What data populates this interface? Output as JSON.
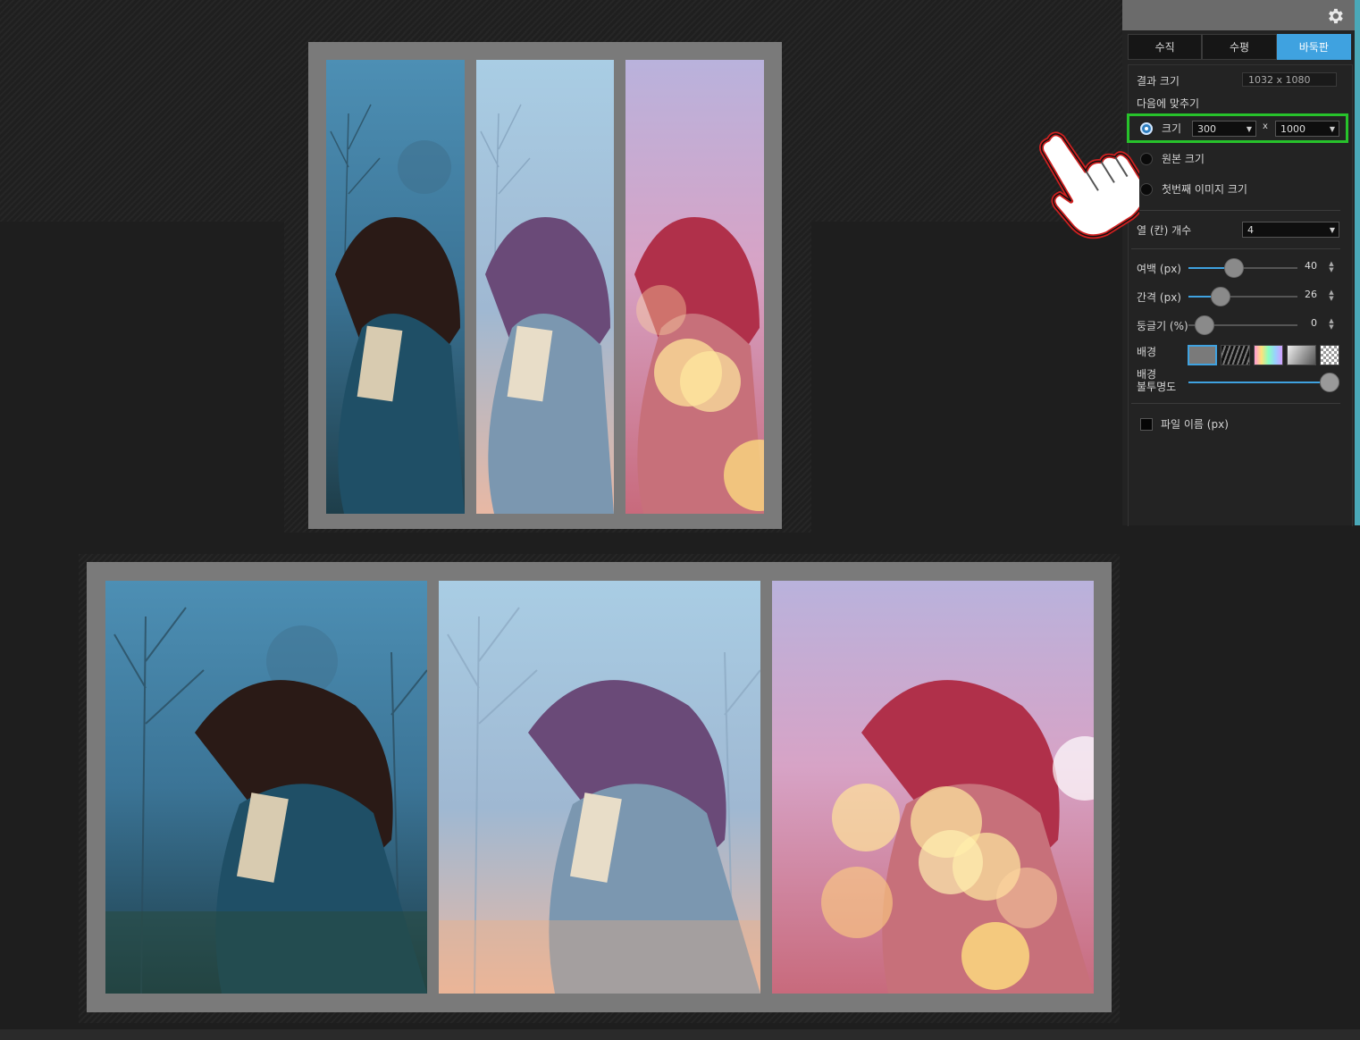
{
  "panel": {
    "tabs": [
      {
        "label": "수직",
        "active": false
      },
      {
        "label": "수평",
        "active": false
      },
      {
        "label": "바둑판",
        "active": true
      }
    ],
    "result_size_label": "결과 크기",
    "result_size_value": "1032 x 1080",
    "fit_to_label": "다음에 맞추기",
    "size_option_label": "크기",
    "size_width": "300",
    "size_x": "x",
    "size_height": "1000",
    "original_size_label": "원본 크기",
    "first_image_size_label": "첫번째 이미지 크기",
    "columns_label": "열 (칸) 개수",
    "columns_value": "4",
    "margin_label": "여백 (px)",
    "margin_value": "40",
    "spacing_label": "간격 (px)",
    "spacing_value": "26",
    "roundness_label": "둥글기 (%)",
    "roundness_value": "0",
    "background_label": "배경",
    "background_opacity_label_1": "배경",
    "background_opacity_label_2": "불투명도",
    "filename_label": "파일 이름 (px)",
    "accent_color": "#3fa2e0",
    "highlight_color": "#27c22b"
  },
  "icons": {
    "settings": "gear-icon",
    "pointer": "pointing-hand-icon",
    "dropdown": "chevron-down-icon"
  }
}
